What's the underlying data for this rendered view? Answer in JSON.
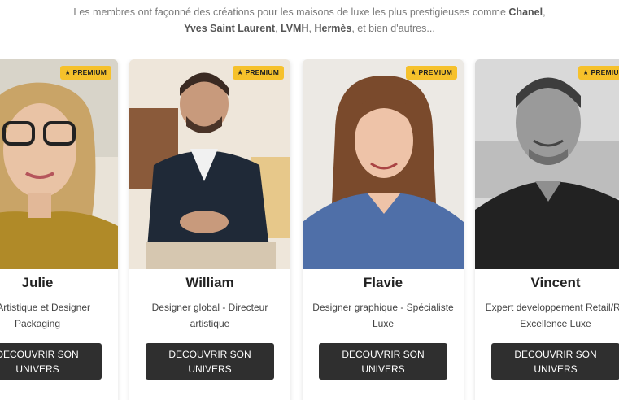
{
  "intro": {
    "line1_prefix": "Les membres ont façonné des créations pour les maisons de luxe les plus prestigieuses comme ",
    "brand_1": "Chanel",
    "line1_suffix": ",",
    "brand_2": "Yves Saint Laurent",
    "sep_1": ", ",
    "brand_3": "LVMH",
    "sep_2": ", ",
    "brand_4": "Hermès",
    "line2_suffix": ", et bien d'autres..."
  },
  "badge_label": "PREMIUM",
  "badge_icon": "star-icon",
  "colors": {
    "badge": "#f6c12b",
    "button": "#2f2f2f"
  },
  "cards": [
    {
      "name": "Julie",
      "role_line1": "ce Artistique et Designer",
      "role_line2": "Packaging",
      "button_line1": "DECOUVRIR SON",
      "button_line2": "UNIVERS"
    },
    {
      "name": "William",
      "role_line1": "Designer global - Directeur",
      "role_line2": "artistique",
      "button_line1": "DECOUVRIR SON",
      "button_line2": "UNIVERS"
    },
    {
      "name": "Flavie",
      "role_line1": "Designer graphique - Spécialiste",
      "role_line2": "Luxe",
      "button_line1": "DECOUVRIR SON",
      "button_line2": "UNIVERS"
    },
    {
      "name": "Vincent",
      "role_line1": "Expert developpement Retail/Re",
      "role_line2": "Excellence Luxe",
      "button_line1": "DECOUVRIR SON",
      "button_line2": "UNIVERS"
    }
  ]
}
